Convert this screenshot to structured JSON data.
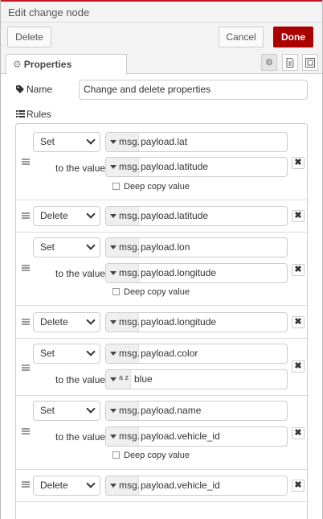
{
  "title": "Edit change node",
  "toolbar": {
    "delete_label": "Delete",
    "cancel_label": "Cancel",
    "done_label": "Done"
  },
  "tabs": [
    {
      "label": "Properties",
      "icon": "gear-icon"
    }
  ],
  "tab_icons": [
    "gear-icon",
    "document-icon",
    "frame-icon"
  ],
  "name": {
    "label": "Name",
    "value": "Change and delete properties"
  },
  "rules_label": "Rules",
  "to_the_value_label": "to the value",
  "deep_copy_label": "Deep copy value",
  "rules": [
    {
      "action": "Set",
      "property_prefix": "msg.",
      "property": "payload.lat",
      "value_prefix": "msg.",
      "value": "payload.latitude",
      "value_type": "msg",
      "deep_copy": false
    },
    {
      "action": "Delete",
      "property_prefix": "msg.",
      "property": "payload.latitude"
    },
    {
      "action": "Set",
      "property_prefix": "msg.",
      "property": "payload.lon",
      "value_prefix": "msg.",
      "value": "payload.longitude",
      "value_type": "msg",
      "deep_copy": false
    },
    {
      "action": "Delete",
      "property_prefix": "msg.",
      "property": "payload.longitude"
    },
    {
      "action": "Set",
      "property_prefix": "msg.",
      "property": "payload.color",
      "value_prefix": "a z",
      "value": "blue",
      "value_type": "str"
    },
    {
      "action": "Set",
      "property_prefix": "msg.",
      "property": "payload.name",
      "value_prefix": "msg.",
      "value": "payload.vehicle_id",
      "value_type": "msg",
      "deep_copy": false
    },
    {
      "action": "Delete",
      "property_prefix": "msg.",
      "property": "payload.vehicle_id"
    }
  ],
  "colors": {
    "accent": "#aa0000",
    "top_line": "#c7141e"
  }
}
